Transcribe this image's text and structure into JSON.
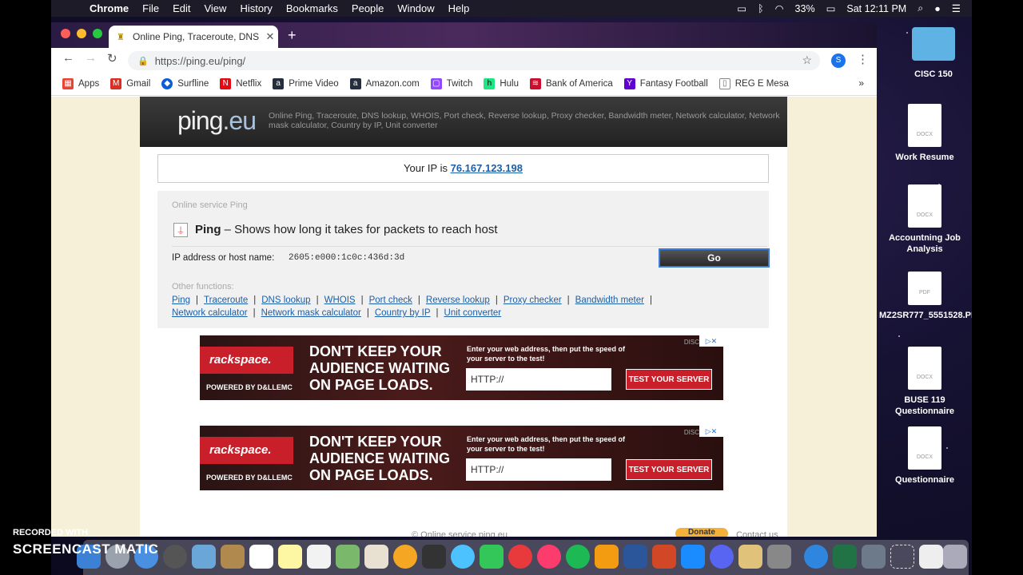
{
  "menubar": {
    "app": "Chrome",
    "items": [
      "File",
      "Edit",
      "View",
      "History",
      "Bookmarks",
      "People",
      "Window",
      "Help"
    ],
    "battery": "33%",
    "clock": "Sat 12:11 PM"
  },
  "browser": {
    "tab_title": "Online Ping, Traceroute, DNS l",
    "url": "https://ping.eu/ping/",
    "profile_initial": "S",
    "bookmarks": [
      {
        "label": "Apps",
        "icon": "apps-grid-icon",
        "color": "#ea4335"
      },
      {
        "label": "Gmail",
        "icon": "gmail-icon",
        "color": "#d93025"
      },
      {
        "label": "Surfline",
        "icon": "surfline-icon",
        "color": "#0b5ed7"
      },
      {
        "label": "Netflix",
        "icon": "netflix-icon",
        "color": "#e50914"
      },
      {
        "label": "Prime Video",
        "icon": "amazon-icon",
        "color": "#232f3e"
      },
      {
        "label": "Amazon.com",
        "icon": "amazon-icon",
        "color": "#232f3e"
      },
      {
        "label": "Twitch",
        "icon": "twitch-icon",
        "color": "#9146ff"
      },
      {
        "label": "Hulu",
        "icon": "hulu-icon",
        "color": "#1ce783"
      },
      {
        "label": "Bank of America",
        "icon": "bank-icon",
        "color": "#c8102e"
      },
      {
        "label": "Fantasy Football",
        "icon": "yahoo-icon",
        "color": "#6001d2"
      },
      {
        "label": "REG E Mesa",
        "icon": "document-icon",
        "color": "#888888"
      }
    ]
  },
  "page": {
    "logo_main": "ping",
    "logo_dot": ".",
    "logo_tld": "eu",
    "tagline": "Online Ping, Traceroute, DNS lookup, WHOIS, Port check, Reverse lookup, Proxy checker, Bandwidth meter, Network calculator, Network mask calculator, Country by IP, Unit converter",
    "ip_prefix": "Your IP is",
    "ip_value": "76.167.123.198",
    "service_title": "Online service Ping",
    "service_name": "Ping",
    "service_desc": "– Shows how long it takes for packets to reach host",
    "ip_label": "IP address or host name:",
    "ip_input_value": "2605:e000:1c0c:436d:3d",
    "go_label": "Go",
    "other_title": "Other functions:",
    "links": [
      "Ping",
      "Traceroute",
      "DNS lookup",
      "WHOIS",
      "Port check",
      "Reverse lookup",
      "Proxy checker",
      "Bandwidth meter",
      "Network calculator",
      "Network mask calculator",
      "Country by IP",
      "Unit converter"
    ],
    "footer": "© Online service ping.eu",
    "donate": "Donate",
    "contact": "Contact us"
  },
  "ad": {
    "brand": "rackspace.",
    "powered": "POWERED BY D&LLEMC",
    "headline": "DON'T KEEP YOUR AUDIENCE WAITING ON PAGE LOADS.",
    "sub": "Enter your web address, then put the speed of your server to the test!",
    "input_value": "HTTP://",
    "button": "TEST YOUR SERVER",
    "disclosure": "DISC"
  },
  "desktop": [
    {
      "label": "CISC 150",
      "kind": "folder"
    },
    {
      "label": "Work Resume",
      "kind": "DOCX"
    },
    {
      "label": "Accountning Job Analysis",
      "kind": "DOCX"
    },
    {
      "label": "MZ2SR777_5551528.PDF",
      "kind": "PDF"
    },
    {
      "label": "BUSE 119 Questionnaire",
      "kind": "DOCX"
    },
    {
      "label": "Questionnaire",
      "kind": "DOCX"
    }
  ],
  "watermark": {
    "line1": "RECORDED WITH",
    "line2": "SCREENCAST MATIC"
  }
}
